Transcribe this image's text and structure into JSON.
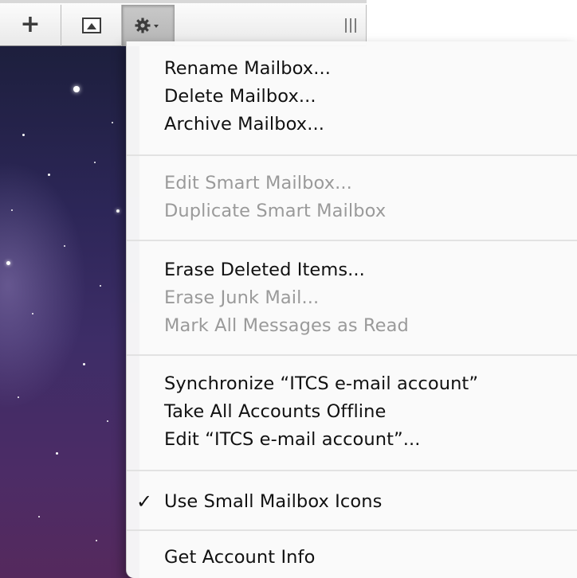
{
  "toolbar": {
    "add_button": "+",
    "show_button_icon": "photo-frame-icon",
    "action_button_icon": "gear-icon",
    "resize_handle_icon": "grip-icon"
  },
  "menu": {
    "groups": [
      {
        "items": [
          {
            "label": "Rename Mailbox...",
            "enabled": true
          },
          {
            "label": "Delete Mailbox...",
            "enabled": true
          },
          {
            "label": "Archive Mailbox...",
            "enabled": true
          }
        ]
      },
      {
        "items": [
          {
            "label": "Edit Smart Mailbox...",
            "enabled": false
          },
          {
            "label": "Duplicate Smart Mailbox",
            "enabled": false
          }
        ]
      },
      {
        "items": [
          {
            "label": "Erase Deleted Items...",
            "enabled": true
          },
          {
            "label": "Erase Junk Mail...",
            "enabled": false
          },
          {
            "label": "Mark All Messages as Read",
            "enabled": false
          }
        ]
      },
      {
        "items": [
          {
            "label": "Synchronize “ITCS e-mail account”",
            "enabled": true
          },
          {
            "label": "Take All Accounts Offline",
            "enabled": true
          },
          {
            "label": "Edit “ITCS e-mail account”...",
            "enabled": true
          }
        ]
      },
      {
        "items": [
          {
            "label": "Use Small Mailbox Icons",
            "enabled": true,
            "checked": true,
            "check_mark": "✓"
          }
        ]
      },
      {
        "items": [
          {
            "label": "Get Account Info",
            "enabled": true
          }
        ]
      }
    ]
  },
  "colors": {
    "enabled_text": "#111111",
    "disabled_text": "#9a9a9a",
    "sidebar_top": "#1d1f3d",
    "sidebar_bottom": "#55295d"
  }
}
